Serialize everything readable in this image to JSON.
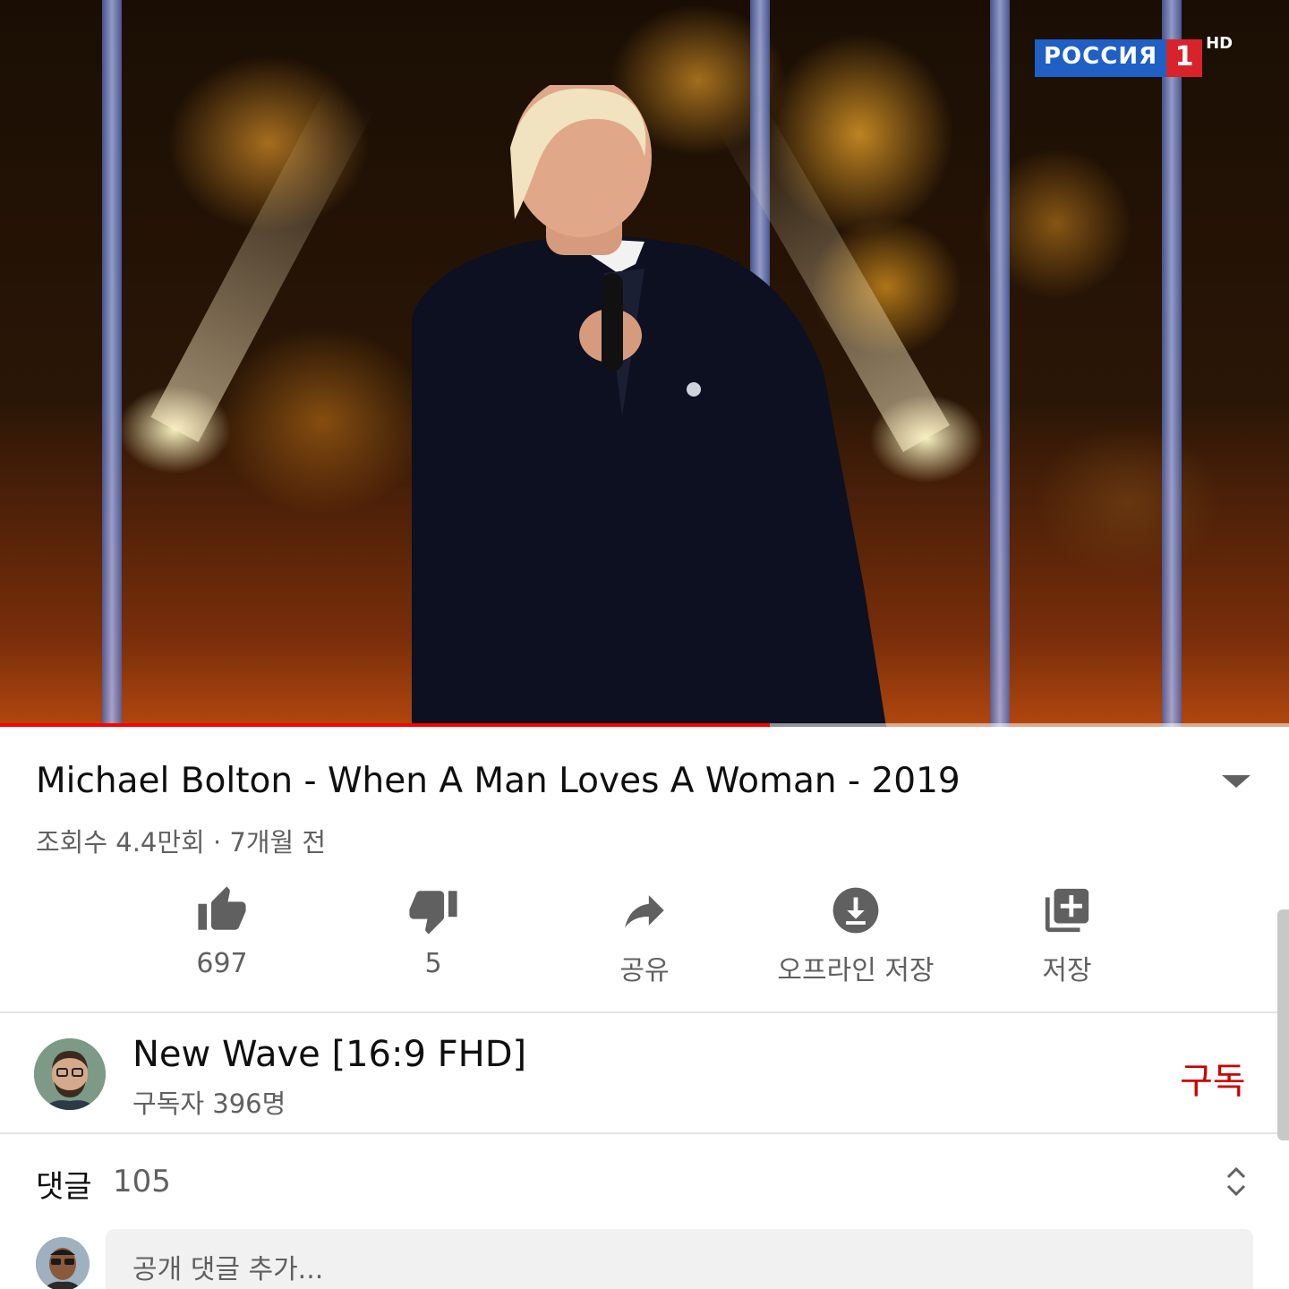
{
  "player": {
    "channel_logo_text": "РОССИЯ",
    "channel_logo_number": "1",
    "channel_logo_badge": "HD",
    "progress_fraction": 0.597
  },
  "video": {
    "title": "Michael Bolton - When A Man Loves A Woman - 2019",
    "meta": "조회수 4.4만회 · 7개월 전"
  },
  "actions": [
    {
      "icon": "thumbs-up-icon",
      "label": "697"
    },
    {
      "icon": "thumbs-down-icon",
      "label": "5"
    },
    {
      "icon": "share-icon",
      "label": "공유"
    },
    {
      "icon": "download-icon",
      "label": "오프라인 저장"
    },
    {
      "icon": "playlist-add-icon",
      "label": "저장"
    }
  ],
  "channel": {
    "name": "New Wave [16:9 FHD]",
    "subscribers": "구독자 396명",
    "subscribe_label": "구독"
  },
  "comments": {
    "label": "댓글",
    "count": "105",
    "placeholder": "공개 댓글 추가..."
  },
  "colors": {
    "accent_red": "#ff0000",
    "subscribe_red": "#cc0000",
    "secondary_text": "#606060"
  }
}
